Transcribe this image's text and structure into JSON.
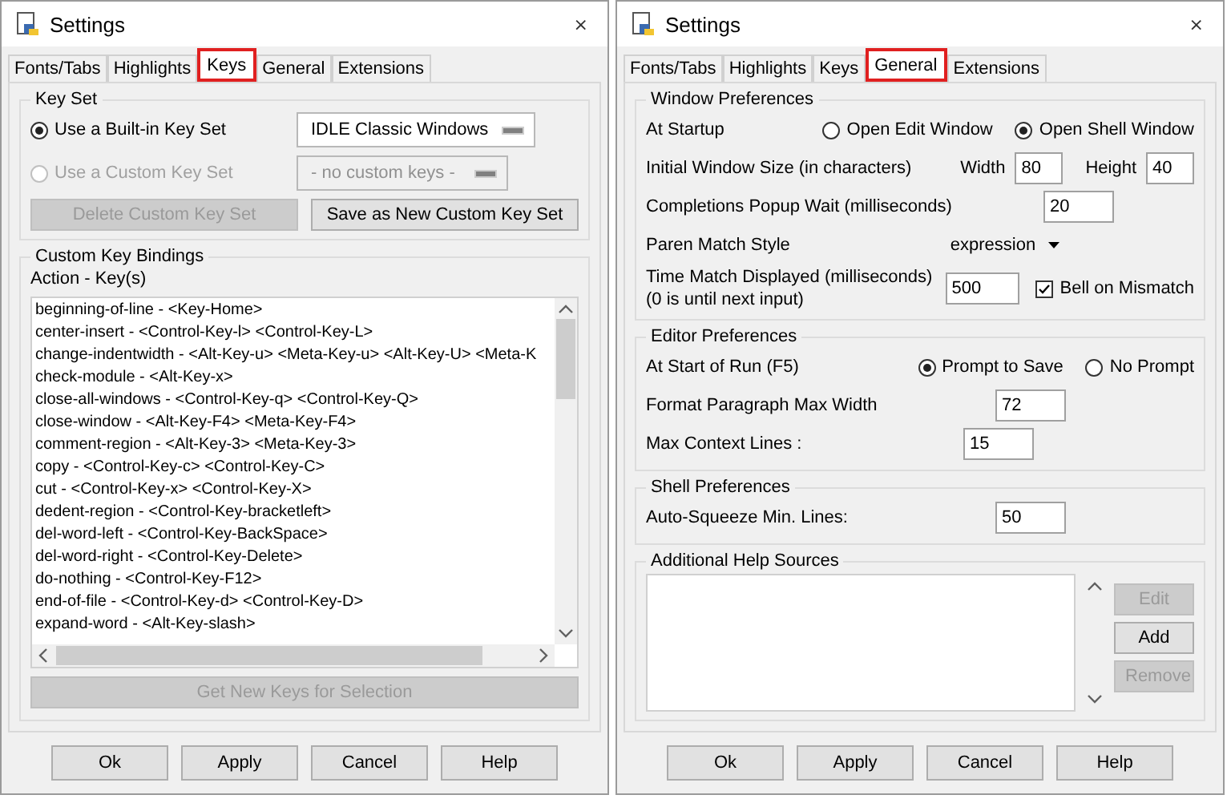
{
  "windows": [
    {
      "kind": "keys",
      "title": "Settings",
      "close": "×",
      "tabs": [
        {
          "label": "Fonts/Tabs",
          "selected": false
        },
        {
          "label": "Highlights",
          "selected": false
        },
        {
          "label": "Keys",
          "selected": true
        },
        {
          "label": "General",
          "selected": false
        },
        {
          "label": "Extensions",
          "selected": false
        }
      ],
      "key_set": {
        "title": "Key Set",
        "options": [
          {
            "label": "Use a Built-in Key Set",
            "selected": true,
            "disabled": false,
            "menu": "IDLE Classic Windows"
          },
          {
            "label": "Use a Custom Key Set",
            "selected": false,
            "disabled": true,
            "menu": "- no custom keys -"
          }
        ],
        "buttons": [
          {
            "label": "Delete Custom Key Set",
            "disabled": true
          },
          {
            "label": "Save as New Custom Key Set",
            "disabled": false
          }
        ]
      },
      "bindings": {
        "title": "Custom Key Bindings",
        "header": "Action - Key(s)",
        "rows": [
          "beginning-of-line - <Key-Home>",
          "center-insert - <Control-Key-l> <Control-Key-L>",
          "change-indentwidth - <Alt-Key-u> <Meta-Key-u> <Alt-Key-U> <Meta-K",
          "check-module - <Alt-Key-x>",
          "close-all-windows - <Control-Key-q> <Control-Key-Q>",
          "close-window - <Alt-Key-F4> <Meta-Key-F4>",
          "comment-region - <Alt-Key-3> <Meta-Key-3>",
          "copy - <Control-Key-c> <Control-Key-C>",
          "cut - <Control-Key-x> <Control-Key-X>",
          "dedent-region - <Control-Key-bracketleft>",
          "del-word-left - <Control-Key-BackSpace>",
          "del-word-right - <Control-Key-Delete>",
          "do-nothing - <Control-Key-F12>",
          "end-of-file - <Control-Key-d> <Control-Key-D>",
          "expand-word - <Alt-Key-slash>"
        ],
        "button": {
          "label": "Get New Keys for Selection",
          "disabled": true
        }
      },
      "footer": [
        "Ok",
        "Apply",
        "Cancel",
        "Help"
      ]
    },
    {
      "kind": "general",
      "title": "Settings",
      "close": "×",
      "tabs": [
        {
          "label": "Fonts/Tabs",
          "selected": false
        },
        {
          "label": "Highlights",
          "selected": false
        },
        {
          "label": "Keys",
          "selected": false
        },
        {
          "label": "General",
          "selected": true
        },
        {
          "label": "Extensions",
          "selected": false
        }
      ],
      "sections": [
        {
          "kind": "form",
          "title": "Window Preferences",
          "rows": [
            {
              "kind": "radios",
              "label": "At Startup",
              "options": [
                {
                  "label": "Open Edit Window",
                  "selected": false
                },
                {
                  "label": "Open Shell Window",
                  "selected": true
                }
              ]
            },
            {
              "kind": "size",
              "label": "Initial Window Size  (in characters)",
              "fields": [
                {
                  "label": "Width",
                  "value": "80"
                },
                {
                  "label": "Height",
                  "value": "40"
                }
              ]
            },
            {
              "kind": "entry",
              "label": "Completions Popup Wait (milliseconds)",
              "value": "20"
            },
            {
              "kind": "menu",
              "label": "Paren Match Style",
              "value": "expression"
            },
            {
              "kind": "entry_check",
              "label": "Time Match Displayed (milliseconds)",
              "note": "(0 is until next input)",
              "value": "500",
              "check": {
                "label": "Bell on Mismatch",
                "checked": true
              }
            }
          ]
        },
        {
          "kind": "form",
          "title": "Editor Preferences",
          "rows": [
            {
              "kind": "radios",
              "label": "At Start of Run (F5)",
              "options": [
                {
                  "label": "Prompt to Save",
                  "selected": true
                },
                {
                  "label": "No Prompt",
                  "selected": false
                }
              ]
            },
            {
              "kind": "entry",
              "label": "Format Paragraph Max Width",
              "value": "72"
            },
            {
              "kind": "entry",
              "label": "Max Context Lines :",
              "value": "15"
            }
          ]
        },
        {
          "kind": "form",
          "title": "Shell Preferences",
          "rows": [
            {
              "kind": "entry",
              "label": "Auto-Squeeze Min. Lines:",
              "value": "50"
            }
          ]
        },
        {
          "kind": "help",
          "title": "Additional Help Sources",
          "buttons": [
            {
              "label": "Edit",
              "disabled": true
            },
            {
              "label": "Add",
              "disabled": false
            },
            {
              "label": "Remove",
              "disabled": true
            }
          ]
        }
      ],
      "footer": [
        "Ok",
        "Apply",
        "Cancel",
        "Help"
      ]
    }
  ]
}
